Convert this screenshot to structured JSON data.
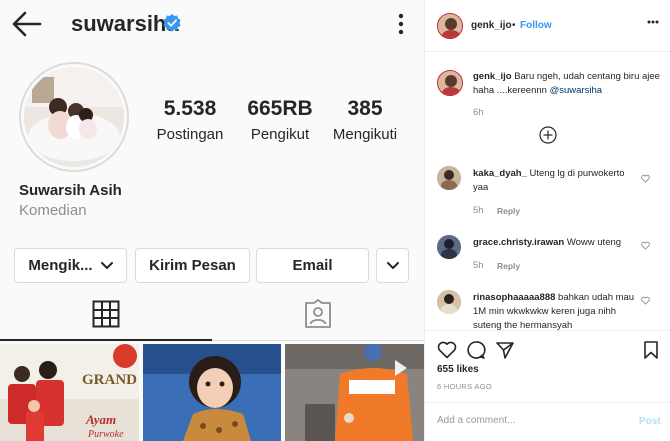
{
  "profile": {
    "username": "suwarsiha",
    "verified": true,
    "stats": [
      {
        "value": "5.538",
        "label": "Postingan"
      },
      {
        "value": "665RB",
        "label": "Pengikut"
      },
      {
        "value": "385",
        "label": "Mengikuti"
      }
    ],
    "full_name": "Suwarsih Asih",
    "category": "Komedian",
    "buttons": {
      "following": "Mengik...",
      "message": "Kirim Pesan",
      "email": "Email"
    },
    "thumbs": [
      {
        "caption": "GRAND OP",
        "subcaption": "Ayam",
        "subcaption2": "Purwoke"
      },
      {
        "caption": ""
      },
      {
        "caption": ""
      }
    ]
  },
  "post": {
    "author": "genk_ijo",
    "separator": "•",
    "follow_label": "Follow",
    "caption": {
      "user": "genk_ijo",
      "text": "Baru ngeh, udah centang biru ajee haha ....kereennn",
      "mention": "@suwarsiha",
      "time": "6h"
    },
    "comments": [
      {
        "user": "kaka_dyah_",
        "text": "Uteng lg di purwokerto yaa",
        "time": "5h",
        "reply": "Reply"
      },
      {
        "user": "grace.christy.irawan",
        "text": "Woww uteng",
        "time": "5h",
        "reply": "Reply"
      },
      {
        "user": "rinasophaaaaa888",
        "text": "bahkan udah mau 1M min wkwkwkw keren juga nihh suteng the hermansyah",
        "time": "",
        "reply": ""
      }
    ],
    "likes": "655 likes",
    "ago": "6 HOURS AGO",
    "add_comment_placeholder": "Add a comment...",
    "post_label": "Post"
  },
  "colors": {
    "link": "#3897f0",
    "verified": "#3897f0",
    "muted": "#8e8e8e",
    "text": "#262626"
  },
  "icons": [
    "back-arrow-icon",
    "verified-badge-icon",
    "more-vertical-icon",
    "chevron-down-icon",
    "grid-icon",
    "tagged-icon",
    "heart-icon",
    "comment-icon",
    "share-icon",
    "bookmark-icon",
    "plus-circle-icon",
    "more-horizontal-icon"
  ]
}
